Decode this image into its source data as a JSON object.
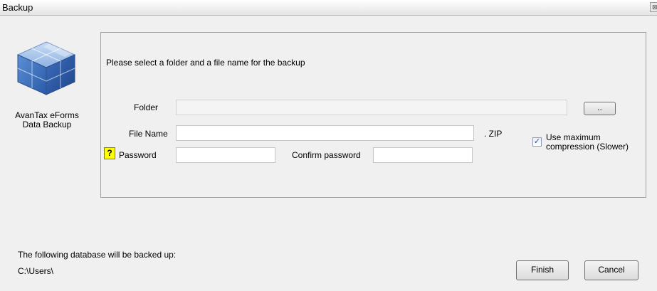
{
  "window": {
    "title": "Backup",
    "close_glyph": "⊠"
  },
  "sidebar": {
    "logo_icon": "cube-stack-icon",
    "caption": "AvanTax eForms Data Backup"
  },
  "panel": {
    "instruction": "Please select a folder and a file name for the backup",
    "folder": {
      "label": "Folder",
      "value": "",
      "browse_label": ".."
    },
    "file_name": {
      "label": "File Name",
      "value": "",
      "extension": ". ZIP"
    },
    "password": {
      "help_glyph": "?",
      "label": "Password",
      "value": ""
    },
    "confirm_password": {
      "label": "Confirm password",
      "value": ""
    },
    "compression": {
      "label": "Use maximum compression (Slower)",
      "checked": true,
      "check_glyph": "✓"
    }
  },
  "footer": {
    "database_notice": "The following database will be backed up:",
    "database_path": "C:\\Users\\",
    "finish_label": "Finish",
    "cancel_label": "Cancel"
  }
}
